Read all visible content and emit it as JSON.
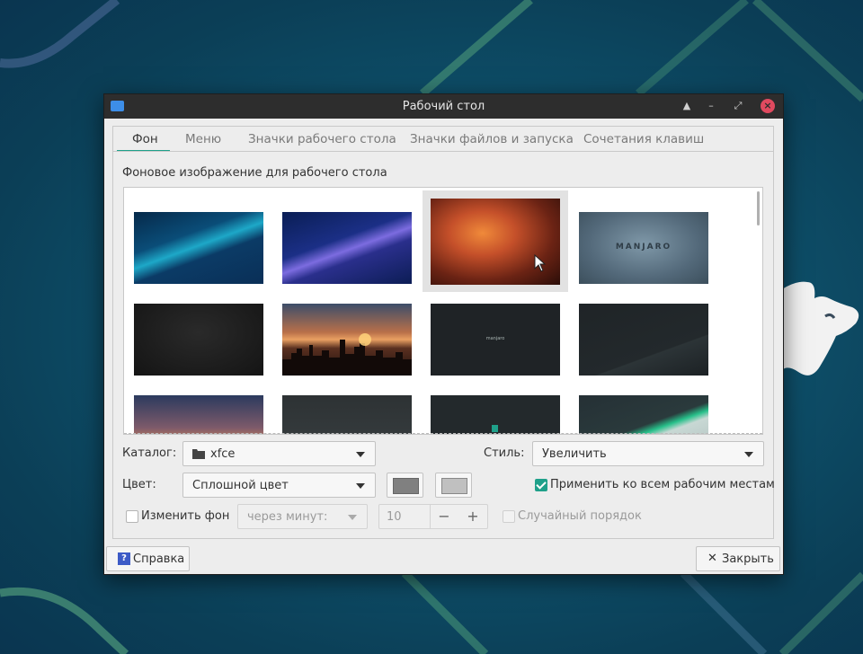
{
  "window": {
    "title": "Рабочий стол"
  },
  "tabs": [
    {
      "label": "Фон",
      "active": true
    },
    {
      "label": "Меню"
    },
    {
      "label": "Значки рабочего стола"
    },
    {
      "label": "Значки файлов и запуска"
    },
    {
      "label": "Сочетания клавиш"
    }
  ],
  "background": {
    "section_label": "Фоновое изображение для рабочего стола",
    "wallpapers": [
      {
        "name": "teal-waves",
        "selected": false
      },
      {
        "name": "blue-purple-waves",
        "selected": false
      },
      {
        "name": "canyon",
        "selected": true
      },
      {
        "name": "manjaro-logo-gray",
        "text": "MANJARO",
        "selected": false
      },
      {
        "name": "dark-gray",
        "selected": false
      },
      {
        "name": "city-sunset",
        "selected": false
      },
      {
        "name": "dark-manjaro-center",
        "text": "manjaro",
        "selected": false
      },
      {
        "name": "dark-diagonal",
        "selected": false
      },
      {
        "name": "clouds-dusk",
        "selected": false
      },
      {
        "name": "dark-gray-2",
        "selected": false
      },
      {
        "name": "dark-green-mark",
        "selected": false
      },
      {
        "name": "green-stripes",
        "selected": false
      }
    ],
    "catalog": {
      "label": "Каталог:",
      "value": "xfce"
    },
    "style": {
      "label": "Стиль:",
      "value": "Увеличить"
    },
    "color": {
      "label": "Цвет:",
      "value": "Сплошной цвет",
      "primary": "#808080",
      "secondary": "#c0c0c0"
    },
    "apply_all": {
      "label": "Применить ко всем рабочим местам",
      "checked": true
    },
    "change_bg": {
      "label": "Изменить фон",
      "checked": false
    },
    "interval": {
      "value": "через минут:",
      "number": "10",
      "minus": "−",
      "plus": "+"
    },
    "random_order": {
      "label": "Случайный порядок",
      "checked": false
    }
  },
  "footer": {
    "help": "Справка",
    "close": "Закрыть"
  },
  "colors": {
    "accent": "#1fa08a",
    "close_button": "#e04a5f",
    "titlebar": "#2d2d2d"
  }
}
